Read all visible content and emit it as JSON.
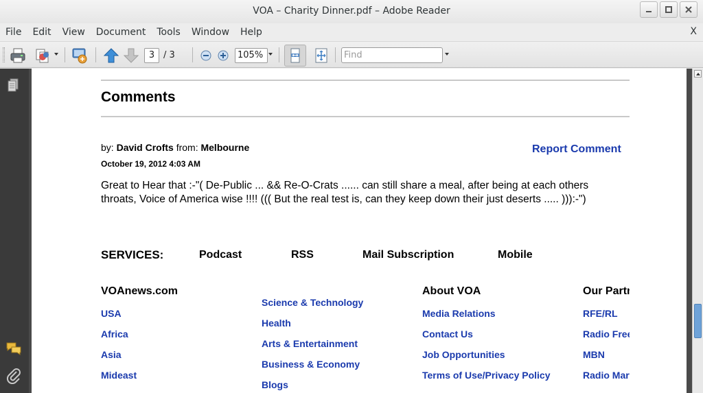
{
  "window": {
    "title": "VOA – Charity Dinner.pdf – Adobe Reader"
  },
  "menubar": {
    "items": [
      "File",
      "Edit",
      "View",
      "Document",
      "Tools",
      "Window",
      "Help"
    ],
    "close_label": "X"
  },
  "toolbar": {
    "current_page": "3",
    "page_total": "/ 3",
    "zoom": "105%",
    "find_placeholder": "Find",
    "icons": [
      "print-icon",
      "create-pdf-icon",
      "collaborate-icon",
      "previous-page-icon",
      "next-page-icon",
      "zoom-out-icon",
      "zoom-in-icon",
      "fit-width-icon",
      "fit-page-icon"
    ]
  },
  "navpane": {
    "icons": [
      "pages-icon",
      "comments-icon",
      "attachments-icon"
    ]
  },
  "document": {
    "comments_heading": "Comments",
    "comment": {
      "by_prefix": "by:",
      "author": "David Crofts",
      "from_prefix": "from:",
      "location": "Melbourne",
      "date": "October 19, 2012 4:03 AM",
      "report_link": "Report Comment",
      "body": "Great to Hear that :-\"( De-Public ... && Re-O-Crats ...... can still share a meal, after being at each others throats, Voice of America wise !!!! ((( But the real test is, can they keep down their just deserts ..... ))):-\")"
    },
    "services": {
      "label": "SERVICES:",
      "items": [
        "Podcast",
        "RSS",
        "Mail Subscription",
        "Mobile"
      ]
    },
    "footer": {
      "col1": {
        "heading": "VOAnews.com",
        "links": [
          "USA",
          "Africa",
          "Asia",
          "Mideast"
        ]
      },
      "col2": {
        "links": [
          "Science & Technology",
          "Health",
          "Arts & Entertainment",
          "Business & Economy",
          "Blogs"
        ]
      },
      "col3": {
        "heading": "About VOA",
        "links": [
          "Media Relations",
          "Contact Us",
          "Job Opportunities",
          "Terms of Use/Privacy Policy"
        ]
      },
      "col4": {
        "heading": "Our Partners",
        "links": [
          "RFE/RL",
          "Radio Free Asia",
          "MBN",
          "Radio Marti"
        ]
      }
    }
  },
  "colors": {
    "link": "#1a3aad",
    "navpane": "#3a3a3a",
    "scroll_thumb": "#6fa3d9"
  }
}
